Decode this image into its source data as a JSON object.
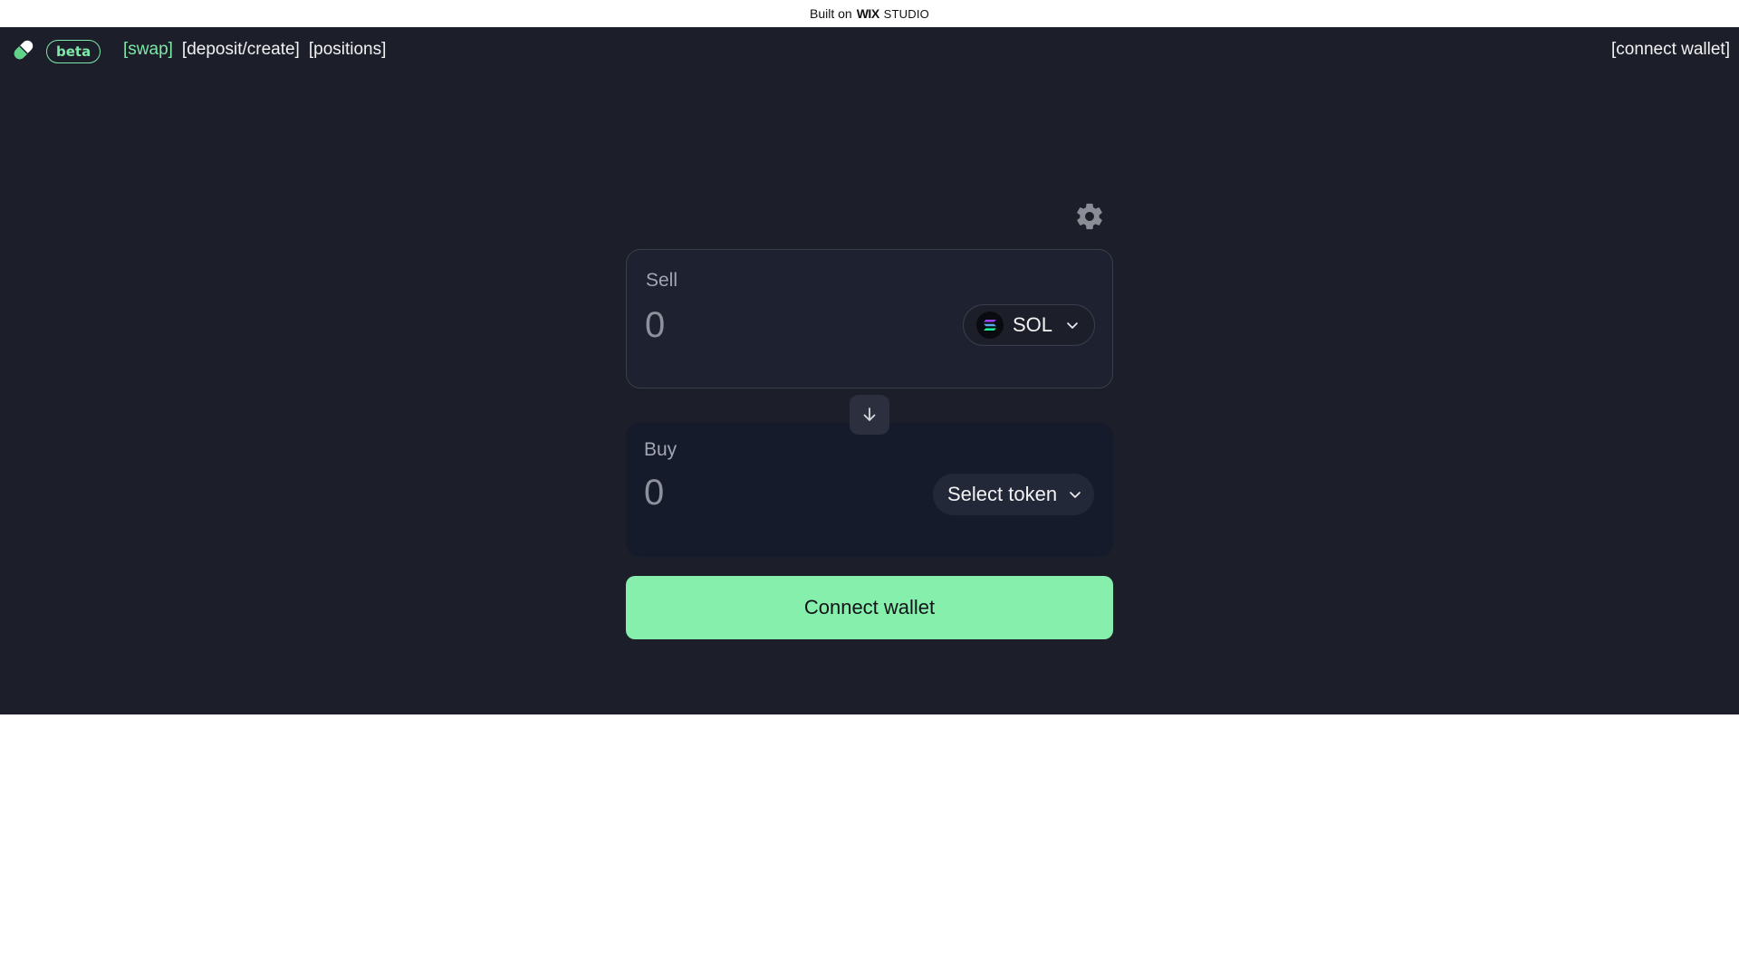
{
  "banner": {
    "built_on": "Built on",
    "wix": "WIX",
    "studio": "STUDIO"
  },
  "header": {
    "logo_icon": "pill-icon",
    "beta_label": "beta",
    "nav": [
      {
        "label": "[swap]",
        "active": true
      },
      {
        "label": "[deposit/create]",
        "active": false
      },
      {
        "label": "[positions]",
        "active": false
      }
    ],
    "connect_wallet_link": "[connect wallet]"
  },
  "swap": {
    "settings_icon": "gear-icon",
    "sell": {
      "label": "Sell",
      "amount_placeholder": "0",
      "token": "SOL",
      "token_icon": "solana-icon"
    },
    "flip_icon": "arrow-down-icon",
    "buy": {
      "label": "Buy",
      "amount_placeholder": "0",
      "token": "Select token"
    },
    "connect_button": "Connect wallet"
  },
  "colors": {
    "background": "#1c1e2a",
    "accent": "#86efac",
    "active_nav": "#7ee8a8"
  }
}
